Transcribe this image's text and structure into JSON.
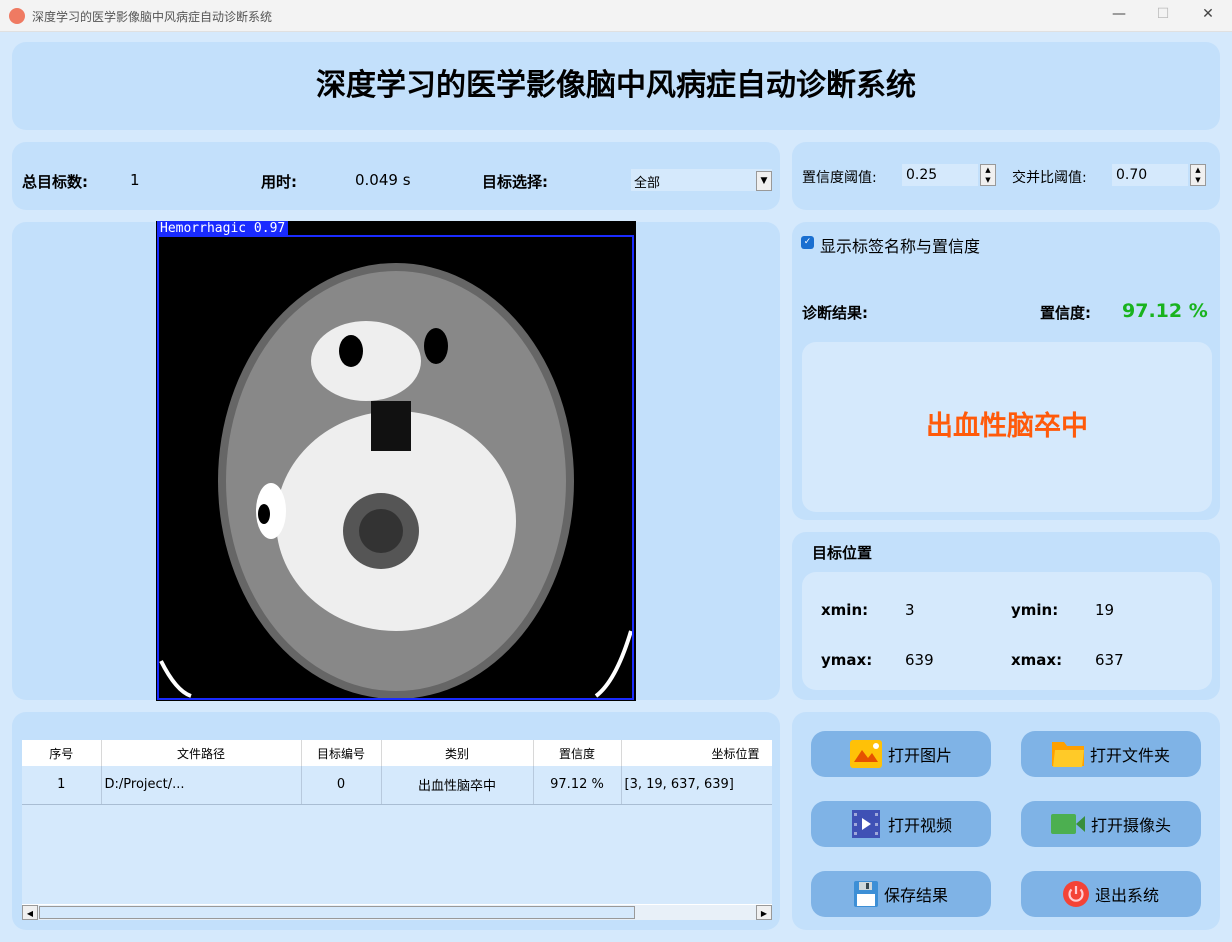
{
  "window": {
    "title": "深度学习的医学影像脑中风病症自动诊断系统",
    "minimize": "—",
    "maximize": "☐",
    "close": "✕"
  },
  "header": {
    "title": "深度学习的医学影像脑中风病症自动诊断系统"
  },
  "stats": {
    "total_label": "总目标数:",
    "total_value": "1",
    "time_label": "用时:",
    "time_value": "0.049 s",
    "select_label": "目标选择:",
    "select_value": "全部"
  },
  "thresholds": {
    "conf_label": "置信度阈值:",
    "conf_value": "0.25",
    "iou_label": "交并比阈值:",
    "iou_value": "0.70"
  },
  "image": {
    "detection_label": "Hemorrhagic  0.97",
    "box_color": "#1a2bff"
  },
  "result": {
    "show_label_text": "显示标签名称与置信度",
    "show_label_checked": true,
    "diag_label": "诊断结果:",
    "conf_label": "置信度:",
    "conf_value": "97.12 %",
    "diagnosis": "出血性脑卒中",
    "diagnosis_color": "#ff5a0a",
    "conf_color": "#19b31e"
  },
  "position": {
    "title": "目标位置",
    "xmin_label": "xmin:",
    "xmin": "3",
    "ymin_label": "ymin:",
    "ymin": "19",
    "ymax_label": "ymax:",
    "ymax": "639",
    "xmax_label": "xmax:",
    "xmax": "637"
  },
  "table": {
    "headers": [
      "序号",
      "文件路径",
      "目标编号",
      "类别",
      "置信度",
      "坐标位置"
    ],
    "rows": [
      [
        "1",
        "D:/Project/...",
        "0",
        "出血性脑卒中",
        "97.12 %",
        "[3, 19, 637, 639]"
      ]
    ]
  },
  "buttons": {
    "open_image": "打开图片",
    "open_folder": "打开文件夹",
    "open_video": "打开视频",
    "open_camera": "打开摄像头",
    "save": "保存结果",
    "exit": "退出系统"
  }
}
